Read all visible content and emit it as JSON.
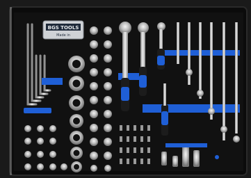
{
  "image": {
    "subject": "tool drawer insert with sockets, ratchets, wrenches and extensions",
    "colors": {
      "background": "#1a1a1a",
      "foam": "#0e0e0e",
      "chrome": "#d4d4d4",
      "accent_blue": "#1f5fd6",
      "handle_black": "#1c1c1c",
      "label_bg": "#cfd2d6",
      "label_text": "#1f2a3a"
    }
  },
  "label": {
    "brand": "BGS TOOLS",
    "subtitle": "Made in"
  }
}
